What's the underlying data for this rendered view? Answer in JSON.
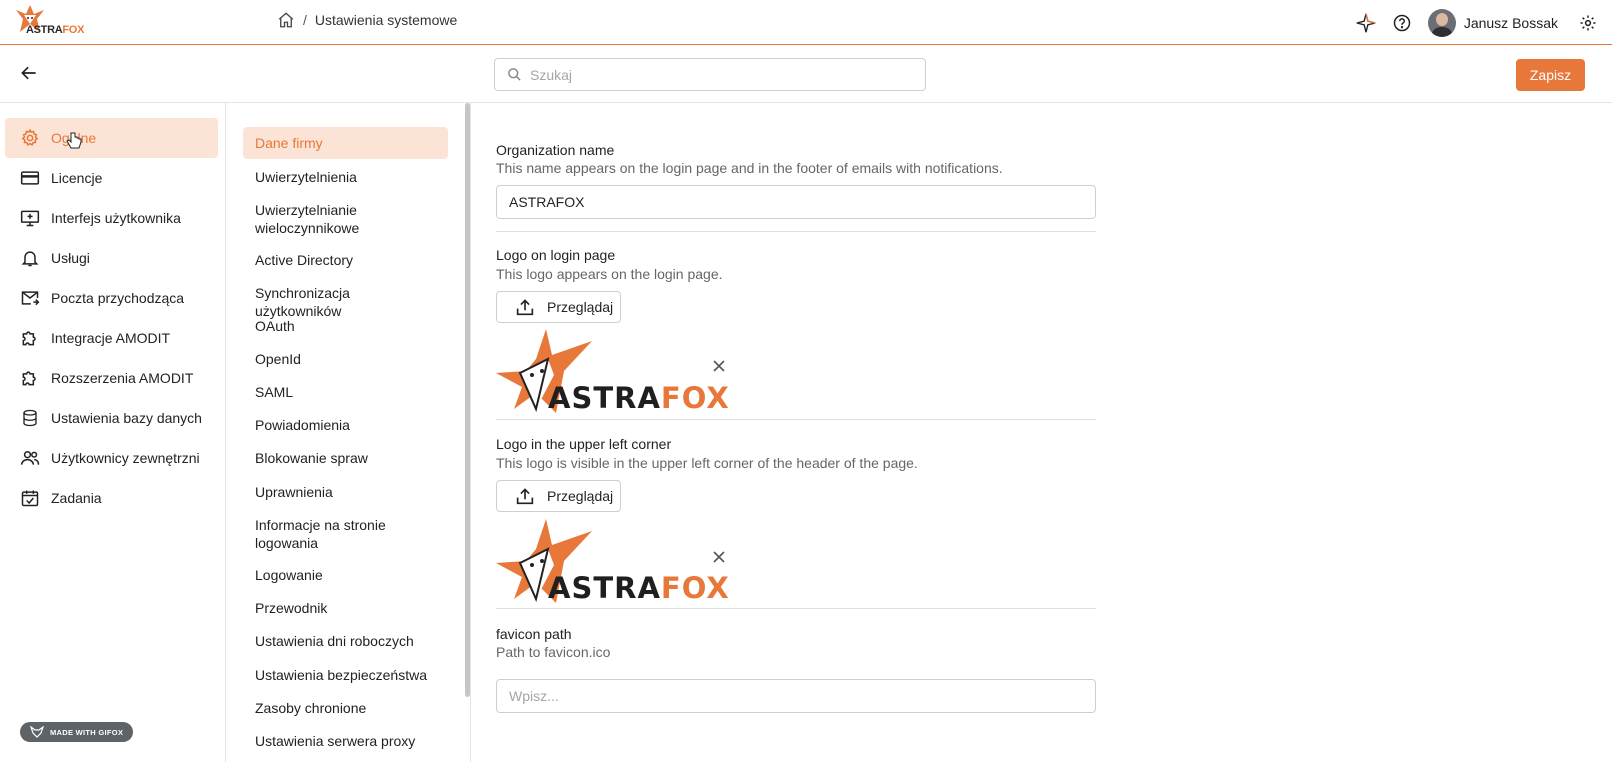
{
  "header": {
    "logo": {
      "part1": "ASTRA",
      "part2": "FOX"
    },
    "breadcrumb": {
      "separator": "/",
      "current": "Ustawienia systemowe"
    },
    "user_name": "Janusz Bossak",
    "icons": [
      "sparkle-icon",
      "help-icon",
      "settings-gear-icon",
      "home-icon"
    ]
  },
  "toolbar": {
    "search_placeholder": "Szukaj",
    "save_label": "Zapisz"
  },
  "sidebar": {
    "items": [
      {
        "label": "Ogólne",
        "icon": "gear-icon",
        "active": true
      },
      {
        "label": "Licencje",
        "icon": "credit-card-icon"
      },
      {
        "label": "Interfejs użytkownika",
        "icon": "monitor-icon"
      },
      {
        "label": "Usługi",
        "icon": "bell-icon"
      },
      {
        "label": "Poczta przychodząca",
        "icon": "mail-icon"
      },
      {
        "label": "Integracje AMODIT",
        "icon": "puzzle-icon"
      },
      {
        "label": "Rozszerzenia AMODIT",
        "icon": "puzzle-icon"
      },
      {
        "label": "Ustawienia bazy danych",
        "icon": "database-icon"
      },
      {
        "label": "Użytkownicy zewnętrzni",
        "icon": "users-icon"
      },
      {
        "label": "Zadania",
        "icon": "calendar-check-icon"
      }
    ],
    "badge": "MADE WITH GIFOX"
  },
  "subnav": {
    "items": [
      {
        "label": "Dane firmy",
        "active": true
      },
      {
        "label": "Uwierzytelnienia"
      },
      {
        "label": "Uwierzytelnianie wieloczynnikowe"
      },
      {
        "label": "Active Directory"
      },
      {
        "label": "Synchronizacja użytkowników"
      },
      {
        "label": "OAuth"
      },
      {
        "label": "OpenId"
      },
      {
        "label": "SAML"
      },
      {
        "label": "Powiadomienia"
      },
      {
        "label": "Blokowanie spraw"
      },
      {
        "label": "Uprawnienia"
      },
      {
        "label": "Informacje na stronie logowania"
      },
      {
        "label": "Logowanie"
      },
      {
        "label": "Przewodnik"
      },
      {
        "label": "Ustawienia dni roboczych"
      },
      {
        "label": "Ustawienia bezpieczeństwa"
      },
      {
        "label": "Zasoby chronione"
      },
      {
        "label": "Ustawienia serwera proxy"
      }
    ]
  },
  "form": {
    "org_name": {
      "label": "Organization name",
      "description": "This name appears on the login page and in the footer of emails with notifications.",
      "value": "ASTRAFOX"
    },
    "logo_login": {
      "label": "Logo on login page",
      "description": "This logo appears on the login page.",
      "browse_label": "Przeglądaj",
      "logo_part1": "ASTRA",
      "logo_part2": "FOX"
    },
    "logo_corner": {
      "label": "Logo in the upper left corner",
      "description": "This logo is visible in the upper left corner of the header of the page.",
      "browse_label": "Przeglądaj",
      "logo_part1": "ASTRA",
      "logo_part2": "FOX"
    },
    "favicon": {
      "label": "favicon path",
      "description": "Path to favicon.ico",
      "placeholder": "Wpisz..."
    }
  },
  "colors": {
    "accent": "#e8773a",
    "accent_light": "#fbe3d5",
    "text": "#222222",
    "muted": "#666666"
  }
}
